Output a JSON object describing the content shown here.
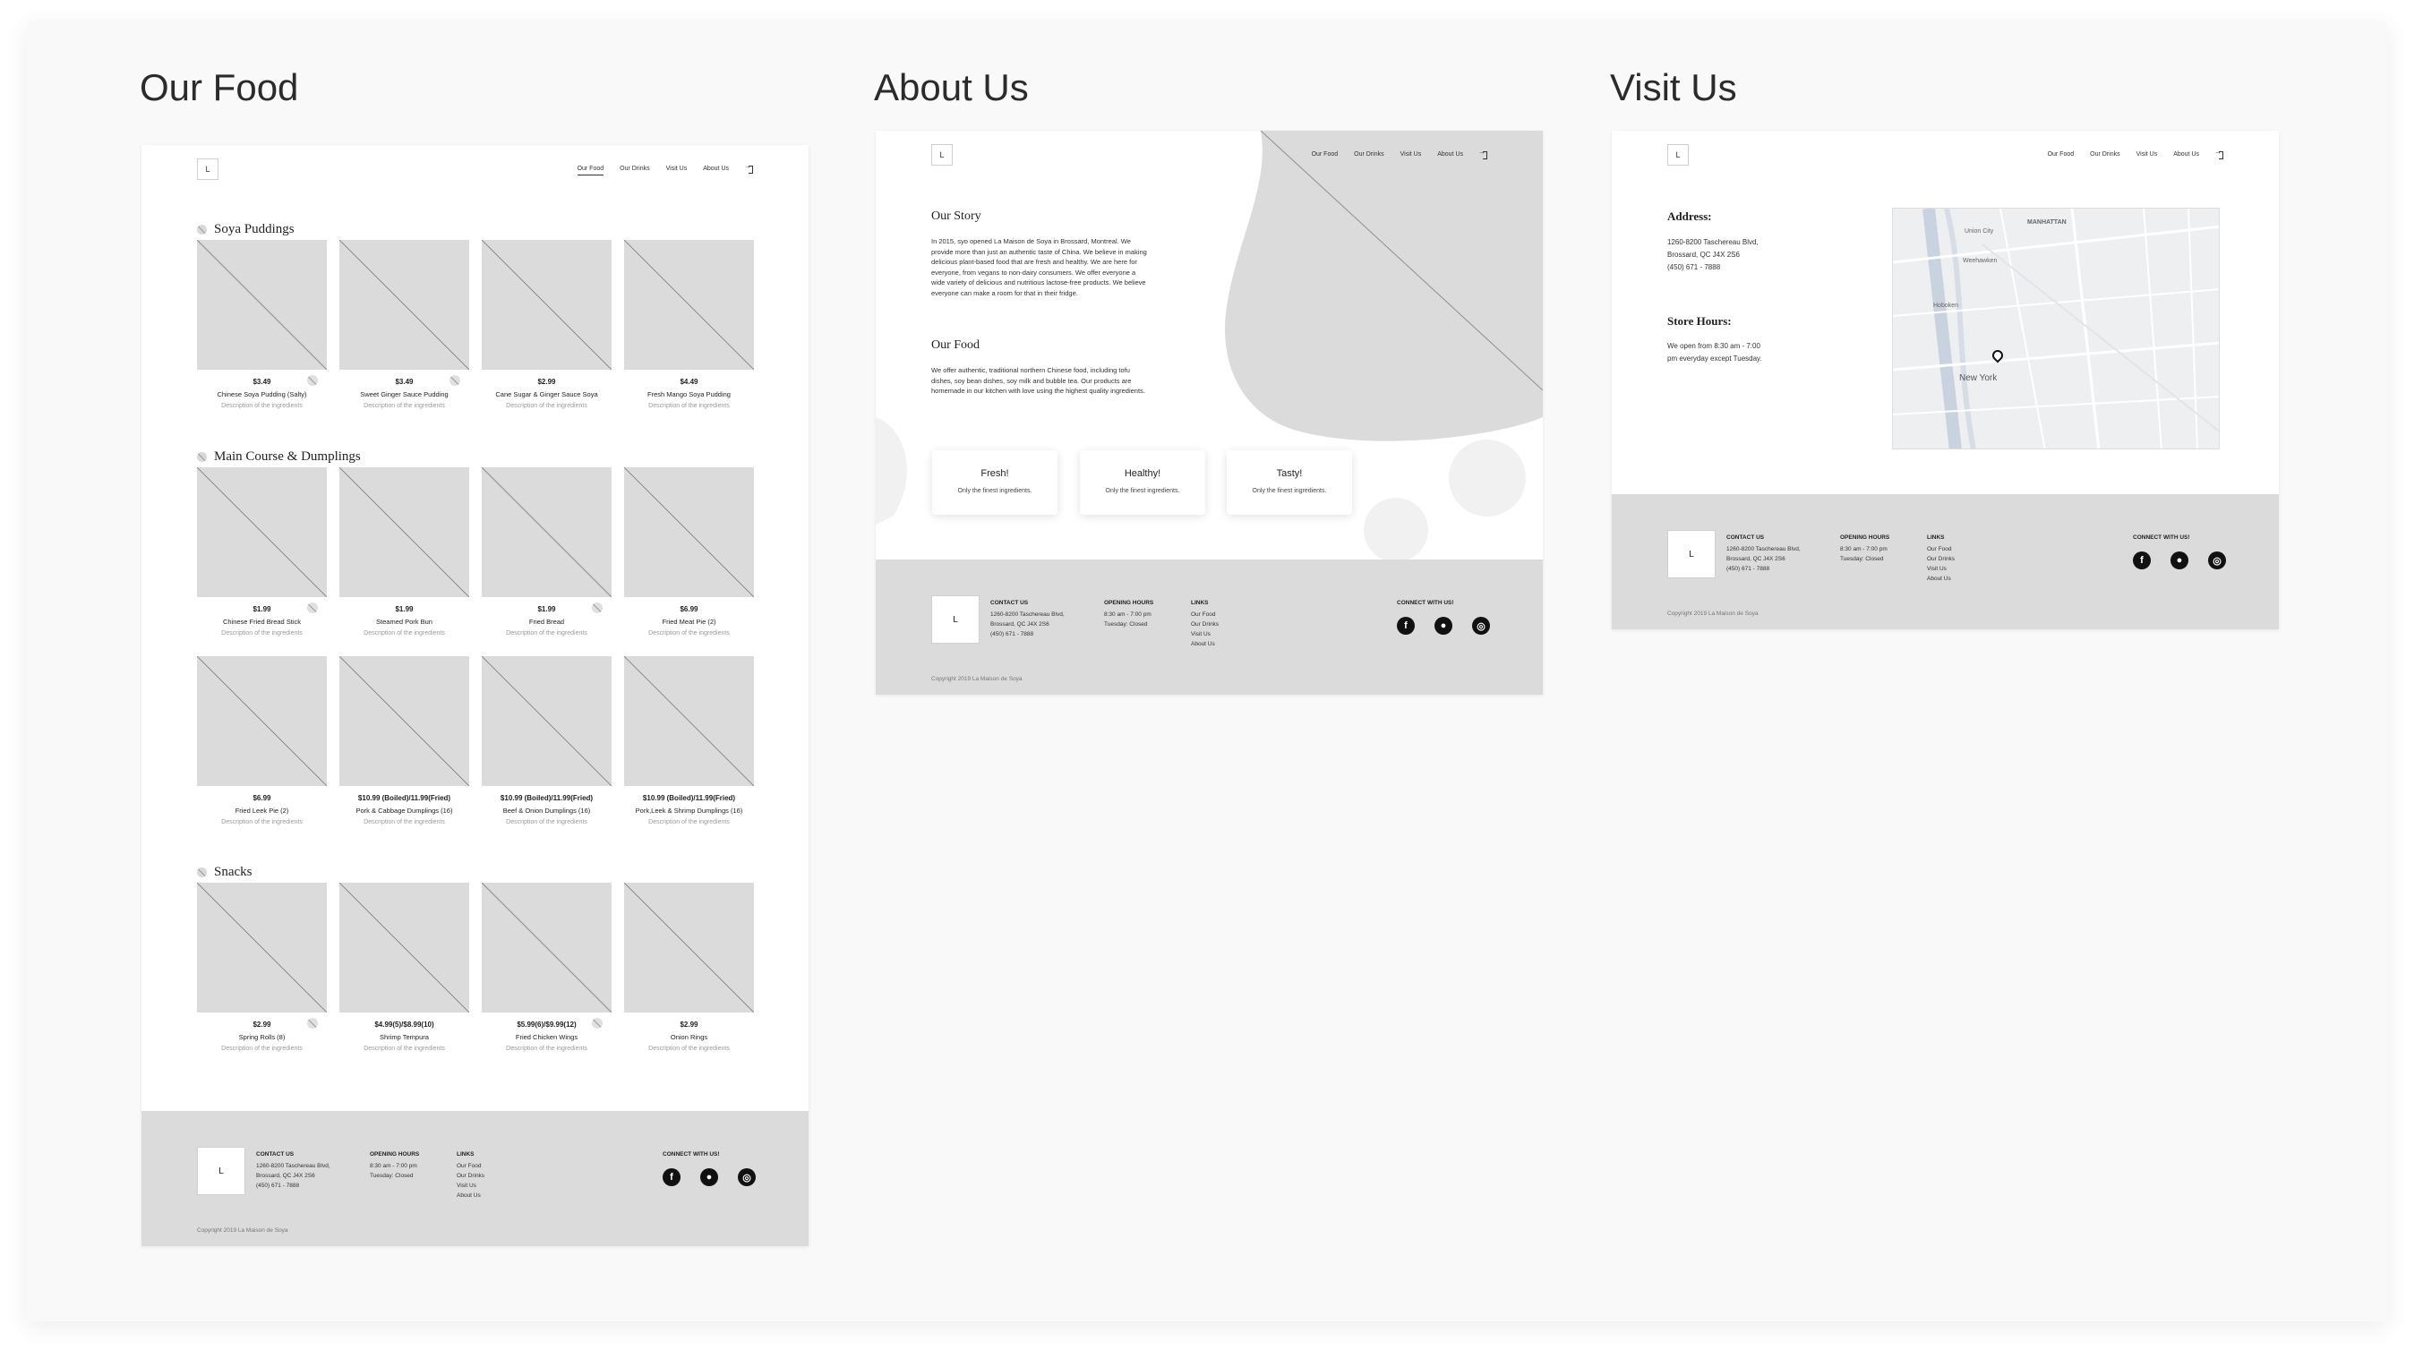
{
  "artboards": {
    "our_food": "Our Food",
    "about_us": "About Us",
    "visit_us": "Visit Us"
  },
  "logo": "L",
  "nav": [
    "Our Food",
    "Our Drinks",
    "Visit Us",
    "About Us"
  ],
  "food": {
    "sections": [
      {
        "title": "Soya Puddings",
        "rows": [
          [
            {
              "price": "$3.49",
              "name": "Chinese Soya Pudding (Salty)",
              "desc": "Description of the ingredients",
              "badge": true
            },
            {
              "price": "$3.49",
              "name": "Sweet Ginger Sauce Pudding",
              "desc": "Description of the ingredients",
              "badge": true
            },
            {
              "price": "$2.99",
              "name": "Cane Sugar & Ginger Sauce Soya",
              "desc": "Description of the ingredients",
              "badge": false
            },
            {
              "price": "$4.49",
              "name": "Fresh Mango Soya Pudding",
              "desc": "Description of the ingredients",
              "badge": false
            }
          ]
        ]
      },
      {
        "title": "Main Course & Dumplings",
        "rows": [
          [
            {
              "price": "$1.99",
              "name": "Chinese Fried Bread Stick",
              "desc": "Description of the ingredients",
              "badge": true
            },
            {
              "price": "$1.99",
              "name": "Steamed Pork Bun",
              "desc": "Description of the ingredients",
              "badge": false
            },
            {
              "price": "$1.99",
              "name": "Fried Bread",
              "desc": "Description of the ingredients",
              "badge": true
            },
            {
              "price": "$6.99",
              "name": "Fried Meat Pie (2)",
              "desc": "Description of the ingredients",
              "badge": false
            }
          ],
          [
            {
              "price": "$6.99",
              "name": "Fried Leek Pie (2)",
              "desc": "Description of the ingredients",
              "badge": false
            },
            {
              "price": "$10.99 (Boiled)/11.99(Fried)",
              "name": "Pork & Cabbage Dumplings (16)",
              "desc": "Description of the ingredients",
              "badge": false
            },
            {
              "price": "$10.99 (Boiled)/11.99(Fried)",
              "name": "Beef & Onion Dumplings (16)",
              "desc": "Description of the ingredients",
              "badge": false
            },
            {
              "price": "$10.99 (Boiled)/11.99(Fried)",
              "name": "Pork,Leek & Shrimp Dumplings (16)",
              "desc": "Description of the ingredients",
              "badge": false
            }
          ]
        ]
      },
      {
        "title": "Snacks",
        "rows": [
          [
            {
              "price": "$2.99",
              "name": "Spring Rolls (8)",
              "desc": "Description of the ingredients",
              "badge": true
            },
            {
              "price": "$4.99(5)/$8.99(10)",
              "name": "Shrimp Tempura",
              "desc": "Description of the ingredients",
              "badge": false
            },
            {
              "price": "$5.99(6)/$9.99(12)",
              "name": "Fried Chicken Wings",
              "desc": "Description of the ingredients",
              "badge": true
            },
            {
              "price": "$2.99",
              "name": "Onion Rings",
              "desc": "Description of the ingredients",
              "badge": false
            }
          ]
        ]
      }
    ]
  },
  "about": {
    "story_title": "Our Story",
    "story_text": "In 2015, syo opened La Maison de Soya in Brossard, Montreal. We provide more than just an authentic taste of China. We believe in making delicious plant-based food that are fresh and healthy. We are here for everyone, from vegans to non-dairy consumers. We offer everyone a wide variety of delicious and nutritious lactose-free products. We believe everyone can make a room for that in their fridge.",
    "food_title": "Our Food",
    "food_text": "We offer authentic, traditional northern Chinese food, including tofu dishes, soy bean dishes, soy milk and bubble tea. Our products are homemade in our kitchen with love using the highest quality ingredients.",
    "features": [
      {
        "title": "Fresh!",
        "desc": "Only the finest ingredients."
      },
      {
        "title": "Healthy!",
        "desc": "Only the finest ingredients."
      },
      {
        "title": "Tasty!",
        "desc": "Only the finest ingredients."
      }
    ]
  },
  "visit": {
    "address_label": "Address:",
    "address_lines": [
      "1260-8200 Taschereau Blvd,",
      "Brossard, QC J4X 2S6",
      "(450) 671 - 7888"
    ],
    "hours_label": "Store Hours:",
    "hours_lines": [
      "We open from 8:30 am - 7:00",
      "pm everyday except Tuesday."
    ],
    "map_labels": [
      "MANHATTAN",
      "Union City",
      "Weehawken",
      "Hoboken",
      "New York"
    ]
  },
  "footer": {
    "contact_h": "CONTACT US",
    "contact_lines": [
      "1260-8200 Taschereau Blvd,",
      "Brossard, QC J4X 2S6",
      "(450) 671 - 7888"
    ],
    "hours_h": "OPENING HOURS",
    "hours_lines": [
      "8:30 am - 7:00 pm",
      "Tuesday: Closed"
    ],
    "links_h": "LINKS",
    "links": [
      "Our Food",
      "Our Drinks",
      "Visit Us",
      "About Us"
    ],
    "connect_h": "CONNECT WITH US!",
    "social": [
      {
        "icon": "facebook-icon",
        "glyph": "f"
      },
      {
        "icon": "wechat-icon",
        "glyph": "●"
      },
      {
        "icon": "instagram-icon",
        "glyph": "◎"
      }
    ],
    "copyright": "Copyright 2019 La Maison de Soya"
  }
}
